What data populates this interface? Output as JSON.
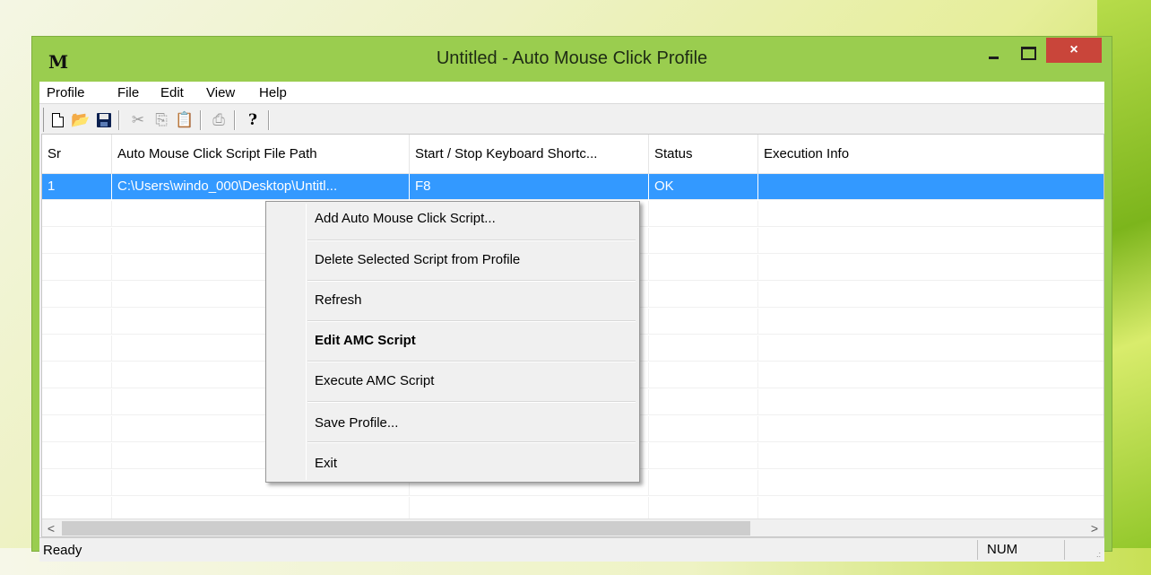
{
  "window": {
    "app_icon": "M",
    "title": "Untitled - Auto Mouse Click Profile",
    "close_glyph": "×"
  },
  "menu": [
    "Profile",
    "File",
    "Edit",
    "View",
    "Help"
  ],
  "toolbar": {
    "icons": [
      "new-file-icon",
      "open-folder-icon",
      "save-icon",
      "cut-icon",
      "copy-icon",
      "paste-icon",
      "print-icon",
      "help-icon"
    ],
    "cut_glyph": "✂",
    "copy_glyph": "⎘",
    "paste_glyph": "📋",
    "print_glyph": "⎙",
    "open_glyph": "📂",
    "help_glyph": "?"
  },
  "table": {
    "columns": [
      "Sr",
      "Auto Mouse Click Script File Path",
      "Start / Stop Keyboard Shortc...",
      "Status",
      "Execution Info"
    ],
    "rows": [
      {
        "sr": "1",
        "path": "C:\\Users\\windo_000\\Desktop\\Untitl...",
        "shortcut": "F8",
        "status": "OK",
        "info": ""
      }
    ],
    "selection_color": "#3399ff"
  },
  "scrollbar": {
    "left_arrow": "<",
    "right_arrow": ">"
  },
  "status": {
    "text": "Ready",
    "num": "NUM",
    "grip": ".:"
  },
  "context_menu": {
    "items": [
      {
        "label": "Add Auto Mouse Click Script...",
        "bold": false
      },
      {
        "label": "Delete Selected Script from Profile",
        "bold": false
      },
      {
        "label": "Refresh",
        "bold": false
      },
      {
        "label": "Edit AMC Script",
        "bold": true
      },
      {
        "label": "Execute AMC Script",
        "bold": false
      },
      {
        "label": "Save Profile...",
        "bold": false
      },
      {
        "label": "Exit",
        "bold": false
      }
    ]
  },
  "colors": {
    "title_bar": "#9acd4f",
    "close_button": "#c9453a"
  }
}
